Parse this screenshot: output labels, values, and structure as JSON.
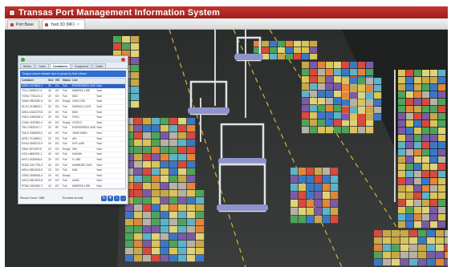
{
  "window": {
    "title": "Transas Port Management Information System"
  },
  "tabs": [
    {
      "label": "Port Base",
      "active": false
    },
    {
      "label": "Yard 3D (MF)",
      "active": true
    }
  ],
  "panel": {
    "tabs": [
      "Berths",
      "Yards",
      "Containers",
      "Equipment",
      "Gates"
    ],
    "active_tab": 2,
    "filter_text": "Drag a column header here to group by that column",
    "columns": [
      "Container",
      "Size",
      "H/S",
      "Status",
      "Line",
      ""
    ],
    "rows": [
      [
        "MSKU 4478601-2",
        "20",
        "DV",
        "Full",
        "EVERGREEN LINE",
        "Yard"
      ],
      [
        "TCLU 3398471-6",
        "40",
        "HC",
        "Full",
        "MAERSK LINE",
        "Yard"
      ],
      [
        "TGHU 7761124-0",
        "20",
        "DV",
        "Full",
        "MSC",
        "Yard"
      ],
      [
        "CMAU 5523087-5",
        "40",
        "DV",
        "Empty",
        "CMA CGM",
        "Yard"
      ],
      [
        "HLXU 2218834-1",
        "20",
        "DV",
        "Full",
        "HAPAG-LLOYD",
        "Yard"
      ],
      [
        "MSCU 6102279-8",
        "40",
        "HC",
        "Full",
        "MSC",
        "Yard"
      ],
      [
        "OOLU 4490136-3",
        "20",
        "DV",
        "Full",
        "OOCL",
        "Yard"
      ],
      [
        "CSNU 1187562-4",
        "40",
        "DV",
        "Empty",
        "COSCO",
        "Yard"
      ],
      [
        "TRLU 9930417-7",
        "20",
        "RF",
        "Full",
        "EVERGREEN LINE",
        "Yard"
      ],
      [
        "YMLU 3365209-0",
        "40",
        "HC",
        "Full",
        "YANG MING",
        "Yard"
      ],
      [
        "APZU 7214850-2",
        "20",
        "DV",
        "Full",
        "APL",
        "Yard"
      ],
      [
        "NYKU 5048713-9",
        "40",
        "DV",
        "Full",
        "NYK LINE",
        "Yard"
      ],
      [
        "ZIMU 2871093-5",
        "20",
        "DV",
        "Empty",
        "ZIM",
        "Yard"
      ],
      [
        "HJCU 6652301-1",
        "40",
        "HC",
        "Full",
        "HANJIN",
        "Yard"
      ],
      [
        "KKFU 1930846-6",
        "20",
        "DV",
        "Full",
        "K LINE",
        "Yard"
      ],
      [
        "SUDU 4417725-3",
        "40",
        "DV",
        "Full",
        "HAMBURG SUD",
        "Yard"
      ],
      [
        "MOLU 8803162-0",
        "20",
        "DV",
        "Full",
        "MOL",
        "Yard"
      ],
      [
        "GESU 3059918-4",
        "40",
        "HC",
        "Empty",
        "",
        "Yard"
      ],
      [
        "UACU 5512670-8",
        "20",
        "DV",
        "Full",
        "UASC",
        "Yard"
      ],
      [
        "PONU 2264081-7",
        "40",
        "DV",
        "Full",
        "MAERSK LINE",
        "Yard"
      ],
      [
        "CAIU 7098345-2",
        "20",
        "DV",
        "Full",
        "",
        "Yard"
      ],
      [
        "BMOU 4136527-9",
        "40",
        "HC",
        "Full",
        "",
        "Yard"
      ],
      [
        "FCIU 6620483-1",
        "20",
        "DV",
        "Empty",
        "",
        "Yard"
      ]
    ],
    "footer_left": "Record Count: 1868",
    "footer_right": "Encoded records",
    "footer_buttons": [
      "refresh-icon",
      "filter-icon",
      "search-icon",
      "export-icon"
    ]
  }
}
